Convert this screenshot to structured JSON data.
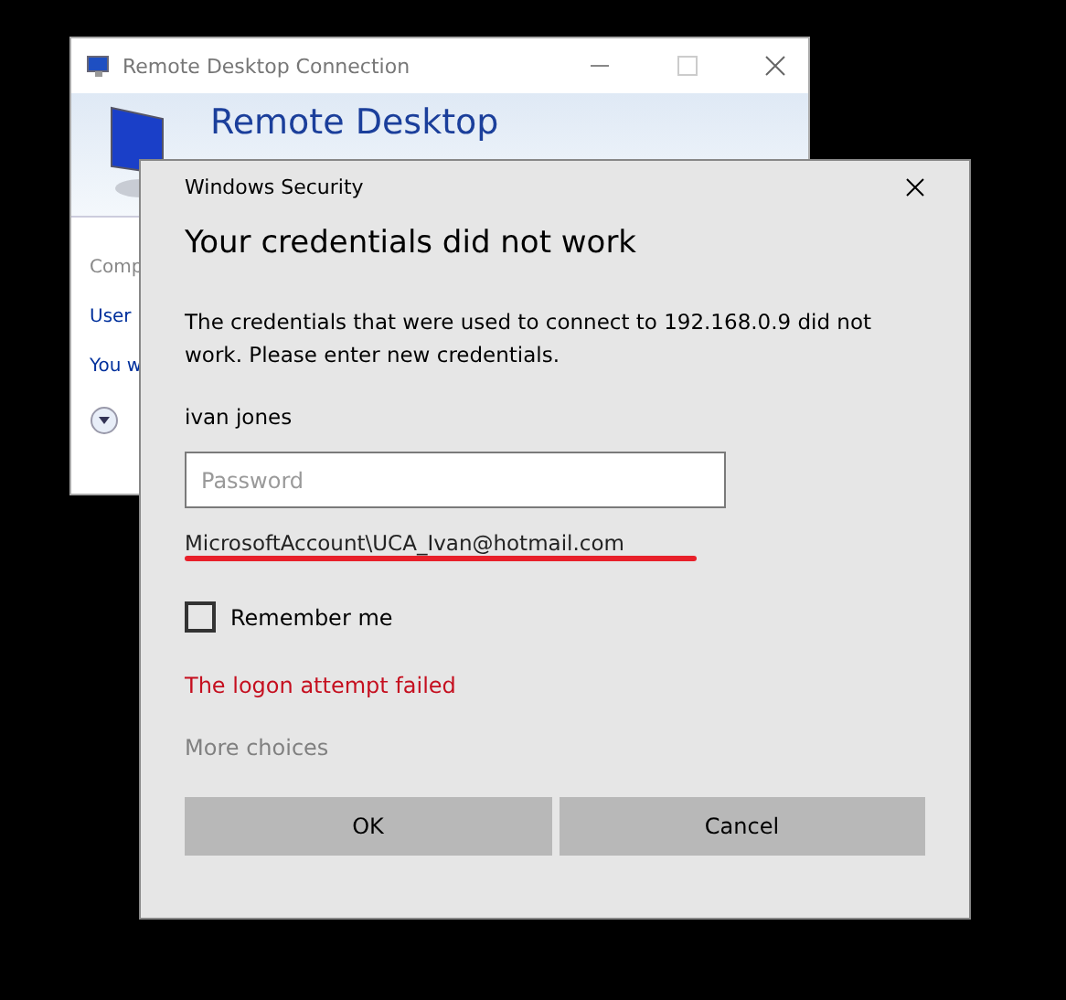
{
  "back_window": {
    "title": "Remote Desktop Connection",
    "banner_title": "Remote Desktop",
    "labels": [
      "Comp",
      "User",
      "You w"
    ]
  },
  "dialog": {
    "title": "Windows Security",
    "heading": "Your credentials did not work",
    "message": "The credentials that were used to connect to 192.168.0.9 did not work. Please enter new credentials.",
    "username": "ivan jones",
    "password": {
      "placeholder": "Password"
    },
    "account": "MicrosoftAccount\\UCA_Ivan@hotmail.com",
    "remember": {
      "label": "Remember me",
      "checked": false
    },
    "error": "The logon attempt failed",
    "more_choices": "More choices",
    "buttons": [
      "OK",
      "Cancel"
    ]
  }
}
